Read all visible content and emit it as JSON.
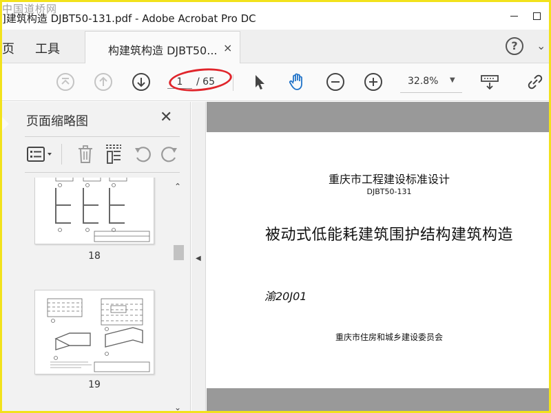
{
  "window": {
    "watermark": "中国道桥网",
    "title": "]建筑构造 DJBT50-131.pdf - Adobe Acrobat Pro DC"
  },
  "tabs": {
    "page_partial": "页",
    "tools": "工具",
    "document": "构建筑构造 DJBT50...",
    "close": "×",
    "help": "?",
    "more": "⌄"
  },
  "toolbar": {
    "current_page": "1",
    "total_pages": "/ 65",
    "zoom": "32.8%"
  },
  "left_pane": {
    "title": "页面缩略图",
    "close": "✕",
    "thumbnails": [
      {
        "label": "18"
      },
      {
        "label": "19"
      }
    ]
  },
  "document": {
    "heading": "重庆市工程建设标准设计",
    "code": "DJBT50-131",
    "main_title": "被动式低能耗建筑围护结构建筑构造",
    "series": "渝20J01",
    "publisher": "重庆市住房和城乡建设委员会"
  },
  "colors": {
    "accent_blue": "#1f72c8",
    "annotation_red": "#e0252b",
    "frame_yellow": "#f2e21c",
    "doc_background": "#999999"
  }
}
